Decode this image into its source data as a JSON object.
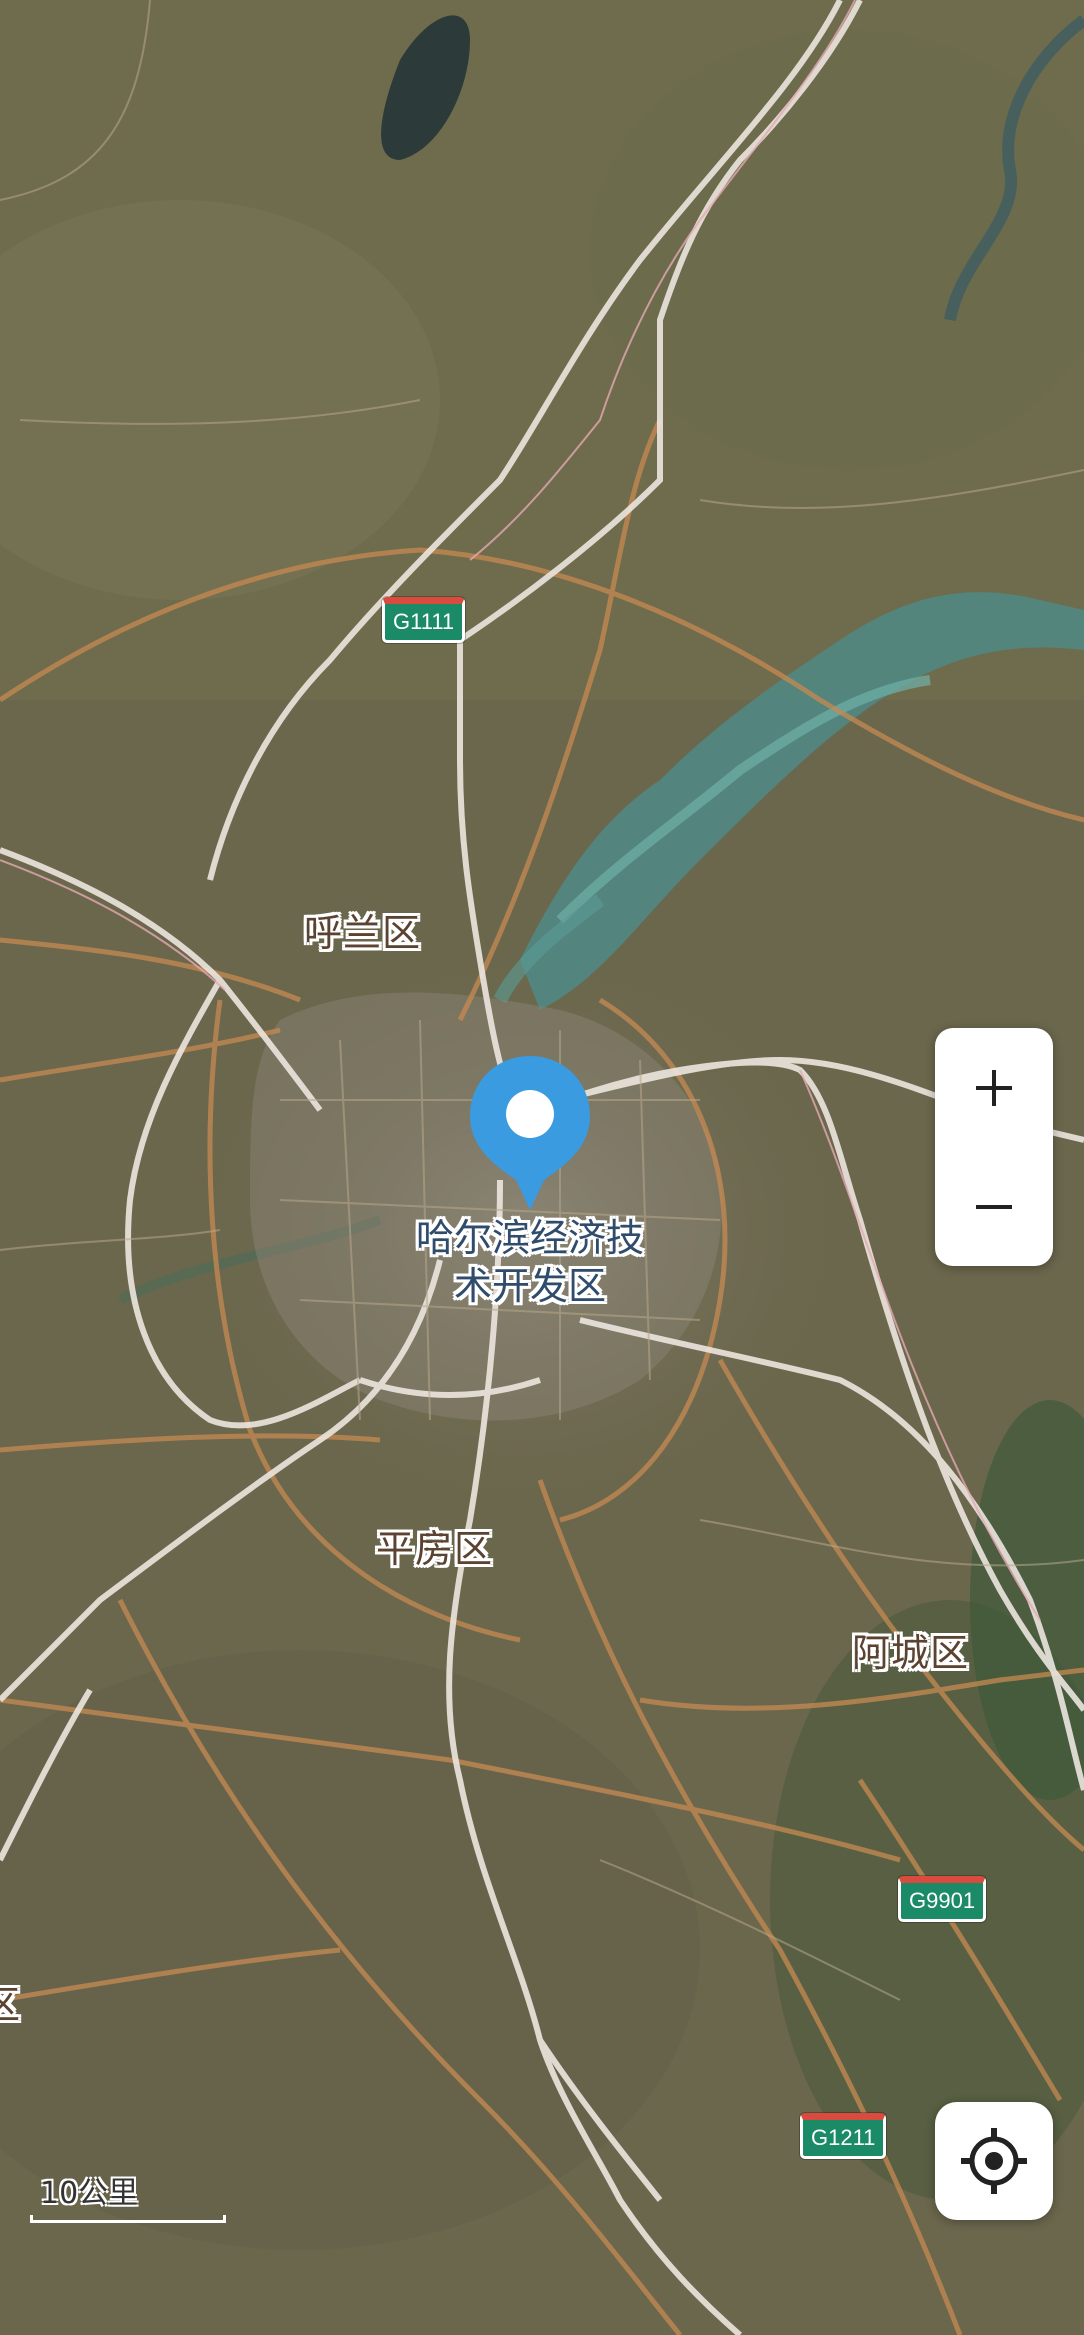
{
  "map": {
    "type": "satellite",
    "colors": {
      "ground": "#6e6a4f",
      "river": "#4f8a86",
      "expressway": "#e9e3dc",
      "road": "#c78a52",
      "pin": "#3a9be0"
    }
  },
  "districts": {
    "hulan": "呼兰区",
    "pingfang": "平房区",
    "acheng": "阿城区",
    "edge_partial": "区"
  },
  "poi": {
    "line1": "哈尔滨经济技",
    "line2": "术开发区"
  },
  "highways": {
    "g1111": "G1111",
    "g9901": "G9901",
    "g1211": "G1211"
  },
  "controls": {
    "zoom_in_icon": "plus-icon",
    "zoom_out_icon": "minus-icon",
    "locate_icon": "crosshair-icon"
  },
  "scale": {
    "label": "10公里"
  },
  "pin": {
    "icon": "location-pin-icon"
  }
}
